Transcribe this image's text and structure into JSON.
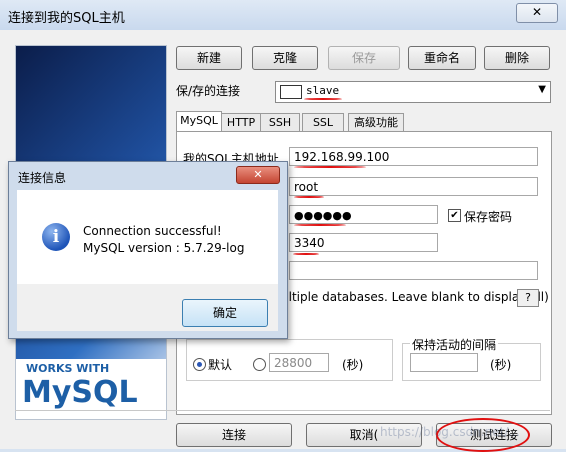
{
  "window": {
    "title": "连接到我的SQL主机",
    "close_glyph": "✕"
  },
  "toolbar": {
    "new_label": "新建",
    "clone_label": "克隆",
    "save_label": "保存",
    "rename_label": "重命名",
    "delete_label": "删除"
  },
  "saved_connection": {
    "label": "保/存的连接",
    "value": "slave"
  },
  "tabs": [
    {
      "label": "MySQL",
      "active": true
    },
    {
      "label": "HTTP",
      "active": false
    },
    {
      "label": "SSH",
      "active": false
    },
    {
      "label": "SSL",
      "active": false
    },
    {
      "label": "高级功能",
      "active": false
    }
  ],
  "mysql_tab": {
    "host_label": "我的SQL主机地址",
    "host_value": "192.168.99.100",
    "user_value": "root",
    "password_value": "●●●●●●",
    "save_password_label": "保存密码",
    "save_password_checked": true,
    "port_value": "3340",
    "databases_hint": "ultiple databases. Leave blank to display all)",
    "help_label": "?",
    "timeout_default_label": "默认",
    "timeout_value": "28800",
    "timeout_unit": "(秒)",
    "keepalive_title": "保持活动的间隔",
    "keepalive_unit": "(秒)"
  },
  "branding": {
    "works_with": "WORKS WITH",
    "mysql_logo": "MySQL"
  },
  "footer": {
    "connect_label": "连接",
    "cancel_label": "取消(",
    "test_label": "测试连接"
  },
  "dialog": {
    "title": "连接信息",
    "close_glyph": "✕",
    "line1": "Connection successful!",
    "line2": "MySQL version : 5.7.29-log",
    "ok_label": "确定"
  },
  "watermark": "https://blog.csdn.net/...",
  "colors": {
    "accent_red": "#e01010",
    "mysql_blue": "#1d5fa6",
    "mysql_orange": "#e48c1a"
  }
}
